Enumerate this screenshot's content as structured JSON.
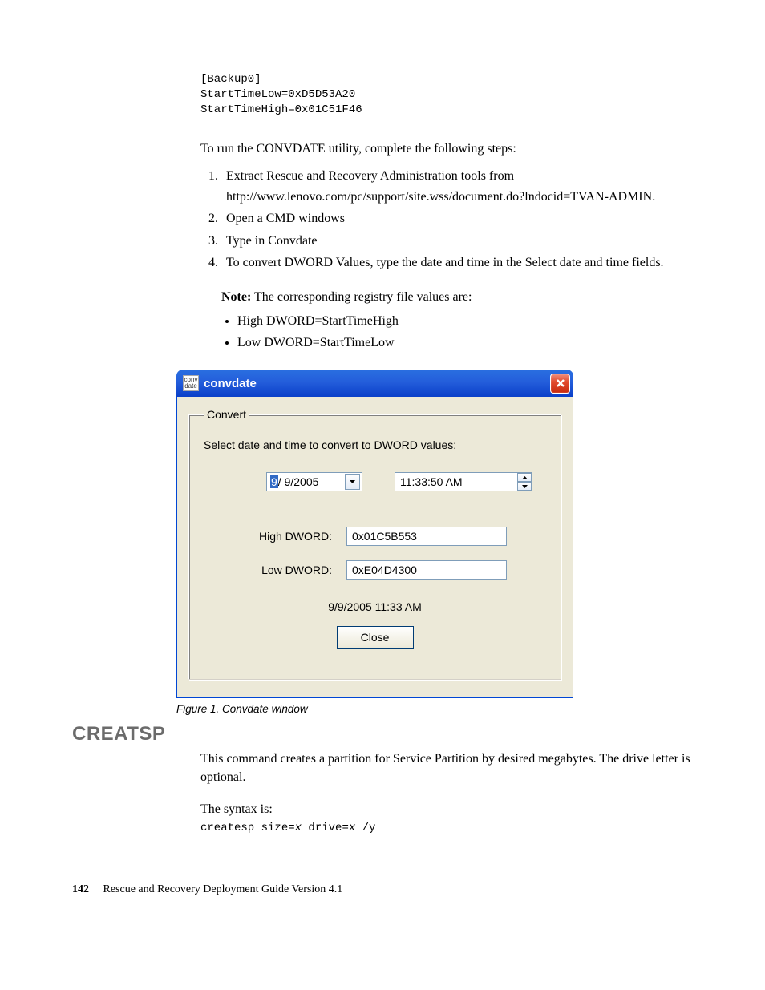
{
  "code_block": {
    "l1": "[Backup0]",
    "l2": "StartTimeLow=0xD5D53A20",
    "l3": "StartTimeHigh=0x01C51F46"
  },
  "intro": "To run the CONVDATE utility, complete the following steps:",
  "steps": {
    "s1": "Extract Rescue and Recovery Administration tools from http://www.lenovo.com/pc/support/site.wss/document.do?lndocid=TVAN-ADMIN.",
    "s2": "Open a CMD windows",
    "s3": "Type in Convdate",
    "s4": "To convert DWORD Values, type the date and time in the Select date and time fields."
  },
  "note_label": "Note:",
  "note_text": " The corresponding registry file values are:",
  "bullets": {
    "b1": "High DWORD=StartTimeHigh",
    "b2": "Low DWORD=StartTimeLow"
  },
  "window": {
    "title": "convdate",
    "group_legend": "Convert",
    "group_text": "Select date and time to convert to DWORD values:",
    "date_sel": "9",
    "date_rest": "/ 9/2005",
    "time_value": "11:33:50 AM",
    "high_label": "High DWORD:",
    "high_value": "0x01C5B553",
    "low_label": "Low DWORD:",
    "low_value": "0xE04D4300",
    "summary": "9/9/2005 11:33 AM",
    "close_btn": "Close",
    "icon_text": "conv date"
  },
  "figure_caption": "Figure 1. Convdate window",
  "creatsp": {
    "heading": "CREATSP",
    "p1": "This command creates a partition for Service Partition by desired megabytes. The drive letter is optional.",
    "p2": "The syntax is:",
    "syntax_a": "createsp size=",
    "syntax_x1": "x",
    "syntax_b": " drive=",
    "syntax_x2": "x",
    "syntax_c": " /y"
  },
  "footer": {
    "page": "142",
    "title": "Rescue and Recovery Deployment Guide Version 4.1"
  }
}
